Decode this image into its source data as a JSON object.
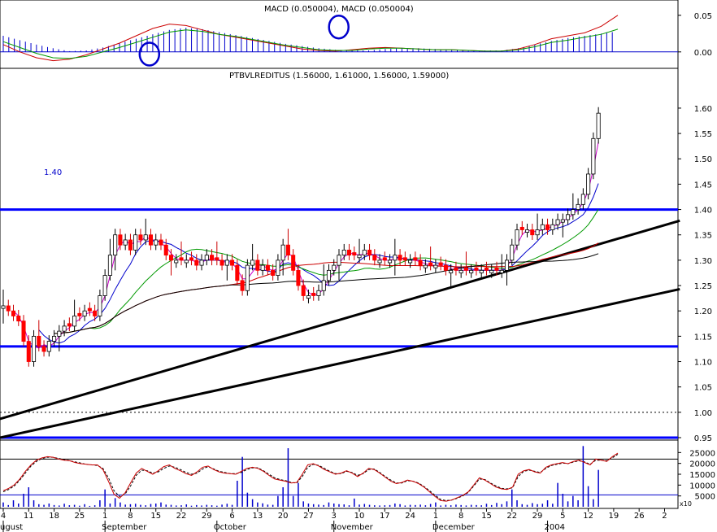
{
  "chart_data": [
    {
      "panel": "macd",
      "type": "line",
      "title": "MACD (0.050004), MACD (0.050004)",
      "ylim": [
        -0.018,
        0.062
      ],
      "y_ticks": [
        "0.05",
        "0.00"
      ],
      "y_tick_values": [
        0.05,
        0.0
      ],
      "series": [
        {
          "color": "#cc0000",
          "values": [
            0.01,
            0.0,
            -0.008,
            -0.012,
            -0.01,
            -0.004,
            0.004,
            0.012,
            0.022,
            0.032,
            0.038,
            0.036,
            0.03,
            0.024,
            0.02,
            0.016,
            0.012,
            0.008,
            0.004,
            0.002,
            0.001,
            0.003,
            0.005,
            0.006,
            0.005,
            0.004,
            0.003,
            0.003,
            0.002,
            0.001,
            0.001,
            0.004,
            0.01,
            0.018,
            0.022,
            0.026,
            0.035,
            0.05
          ]
        },
        {
          "color": "#009900",
          "values": [
            0.014,
            0.006,
            -0.002,
            -0.008,
            -0.009,
            -0.006,
            0.0,
            0.006,
            0.013,
            0.02,
            0.027,
            0.03,
            0.028,
            0.024,
            0.021,
            0.017,
            0.013,
            0.009,
            0.006,
            0.003,
            0.002,
            0.002,
            0.004,
            0.005,
            0.005,
            0.004,
            0.003,
            0.003,
            0.002,
            0.001,
            0.001,
            0.003,
            0.007,
            0.013,
            0.016,
            0.02,
            0.024,
            0.031
          ]
        }
      ],
      "histogram": [
        0.022,
        0.016,
        0.01,
        0.005,
        0.001,
        0.002,
        0.006,
        0.012,
        0.018,
        0.024,
        0.03,
        0.033,
        0.031,
        0.027,
        0.023,
        0.019,
        0.015,
        0.011,
        0.008,
        0.005,
        0.003,
        0.002,
        0.002,
        0.004,
        0.005,
        0.005,
        0.004,
        0.003,
        0.002,
        0.002,
        0.002,
        0.005,
        0.01,
        0.015,
        0.019,
        0.022,
        0.025,
        0.028
      ],
      "hist_color": "#0000cc",
      "circles": [
        {
          "x": 8.8,
          "y": -0.003
        },
        {
          "x": 20.2,
          "y": 0.034
        }
      ]
    },
    {
      "panel": "price",
      "type": "candlestick",
      "title": "PTBVLREDITUS (1.56000, 1.61000, 1.56000, 1.59000)",
      "ylim": [
        0.95,
        1.64
      ],
      "y_ticks": [
        "1.60",
        "1.55",
        "1.50",
        "1.45",
        "1.40",
        "1.35",
        "1.30",
        "1.25",
        "1.20",
        "1.15",
        "1.10",
        "1.05",
        "1.00",
        "0.95"
      ],
      "y_tick_values": [
        1.6,
        1.55,
        1.5,
        1.45,
        1.4,
        1.35,
        1.3,
        1.25,
        1.2,
        1.15,
        1.1,
        1.05,
        1.0,
        0.95
      ],
      "annotations": [
        {
          "text": "1.40",
          "color": "#0000cc"
        }
      ],
      "x_ticks": [
        {
          "label": "4",
          "i": 0
        },
        {
          "label": "11",
          "i": 5
        },
        {
          "label": "18",
          "i": 10
        },
        {
          "label": "25",
          "i": 15
        },
        {
          "label": "1",
          "i": 20
        },
        {
          "label": "8",
          "i": 25
        },
        {
          "label": "15",
          "i": 30
        },
        {
          "label": "22",
          "i": 35
        },
        {
          "label": "29",
          "i": 40
        },
        {
          "label": "6",
          "i": 45
        },
        {
          "label": "13",
          "i": 50
        },
        {
          "label": "20",
          "i": 55
        },
        {
          "label": "27",
          "i": 60
        },
        {
          "label": "3",
          "i": 65
        },
        {
          "label": "10",
          "i": 70
        },
        {
          "label": "17",
          "i": 75
        },
        {
          "label": "24",
          "i": 80
        },
        {
          "label": "1",
          "i": 85
        },
        {
          "label": "8",
          "i": 90
        },
        {
          "label": "15",
          "i": 95
        },
        {
          "label": "22",
          "i": 100
        },
        {
          "label": "29",
          "i": 105
        },
        {
          "label": "5",
          "i": 110
        },
        {
          "label": "12",
          "i": 115
        },
        {
          "label": "19",
          "i": 120
        },
        {
          "label": "26",
          "i": 125
        },
        {
          "label": "2",
          "i": 130
        }
      ],
      "month_labels": [
        {
          "label": "ugust",
          "i": 0
        },
        {
          "label": "September",
          "i": 20
        },
        {
          "label": "October",
          "i": 42
        },
        {
          "label": "November",
          "i": 65
        },
        {
          "label": "December",
          "i": 85
        },
        {
          "label": "2004",
          "i": 107
        }
      ],
      "x_count": 132,
      "close": [
        1.21,
        1.2,
        1.19,
        1.18,
        1.14,
        1.1,
        1.15,
        1.13,
        1.12,
        1.14,
        1.15,
        1.16,
        1.17,
        1.17,
        1.19,
        1.19,
        1.2,
        1.2,
        1.19,
        1.23,
        1.27,
        1.31,
        1.35,
        1.33,
        1.34,
        1.32,
        1.35,
        1.34,
        1.35,
        1.33,
        1.34,
        1.33,
        1.31,
        1.3,
        1.3,
        1.3,
        1.3,
        1.3,
        1.29,
        1.3,
        1.31,
        1.3,
        1.3,
        1.29,
        1.3,
        1.29,
        1.26,
        1.24,
        1.29,
        1.3,
        1.28,
        1.29,
        1.28,
        1.27,
        1.3,
        1.33,
        1.31,
        1.28,
        1.25,
        1.23,
        1.23,
        1.23,
        1.24,
        1.26,
        1.28,
        1.29,
        1.31,
        1.32,
        1.31,
        1.31,
        1.31,
        1.32,
        1.31,
        1.3,
        1.3,
        1.3,
        1.3,
        1.31,
        1.3,
        1.3,
        1.3,
        1.3,
        1.29,
        1.29,
        1.29,
        1.29,
        1.29,
        1.28,
        1.28,
        1.28,
        1.28,
        1.28,
        1.28,
        1.28,
        1.28,
        1.28,
        1.28,
        1.28,
        1.28,
        1.3,
        1.33,
        1.36,
        1.36,
        1.36,
        1.35,
        1.36,
        1.37,
        1.36,
        1.37,
        1.38,
        1.38,
        1.39,
        1.4,
        1.41,
        1.43,
        1.47,
        1.54,
        1.59
      ],
      "open_dir": [
        1,
        -1,
        -1,
        -1,
        -1,
        -1,
        1,
        -1,
        -1,
        1,
        1,
        1,
        1,
        -1,
        1,
        -1,
        1,
        -1,
        -1,
        1,
        1,
        1,
        1,
        -1,
        1,
        -1,
        1,
        -1,
        1,
        -1,
        1,
        -1,
        -1,
        -1,
        1,
        -1,
        1,
        -1,
        -1,
        1,
        1,
        -1,
        -1,
        -1,
        1,
        -1,
        -1,
        -1,
        1,
        1,
        -1,
        1,
        -1,
        -1,
        1,
        1,
        -1,
        -1,
        -1,
        -1,
        1,
        -1,
        1,
        1,
        1,
        1,
        1,
        1,
        -1,
        -1,
        1,
        1,
        -1,
        -1,
        1,
        -1,
        1,
        1,
        -1,
        -1,
        1,
        -1,
        -1,
        1,
        -1,
        1,
        -1,
        -1,
        1,
        -1,
        1,
        -1,
        1,
        -1,
        1,
        -1,
        1,
        -1,
        1,
        1,
        1,
        1,
        -1,
        1,
        -1,
        1,
        1,
        -1,
        1,
        1,
        1,
        1,
        1,
        1,
        1,
        1,
        1,
        1
      ],
      "ma_series": [
        {
          "color": "#cc00cc",
          "period": 3
        },
        {
          "color": "#0000cc",
          "period": 8
        },
        {
          "color": "#009900",
          "period": 18
        },
        {
          "color": "#cc0000",
          "period": 45
        },
        {
          "color": "#000000",
          "period": 80
        }
      ],
      "hlines": [
        {
          "y": 1.4,
          "color": "#0000ff",
          "width": 3
        },
        {
          "y": 1.13,
          "color": "#0000ff",
          "width": 3
        },
        {
          "y": 0.95,
          "color": "#0000ff",
          "width": 3
        }
      ],
      "dotted_line": 1.0,
      "trendlines": [
        {
          "x1": -2,
          "y1": 0.983,
          "x2": 133,
          "y2": 1.378
        },
        {
          "x1": -2,
          "y1": 0.947,
          "x2": 133,
          "y2": 1.243
        }
      ]
    },
    {
      "panel": "volume",
      "type": "bar",
      "ylim": [
        0,
        30000
      ],
      "y_ticks": [
        "25000",
        "20000",
        "15000",
        "10000",
        "5000"
      ],
      "y_tick_values": [
        25000,
        20000,
        15000,
        10000,
        5000
      ],
      "multiplier_label": "x10",
      "hlines": [
        22000,
        5500
      ],
      "volume": [
        2000,
        800,
        3000,
        1500,
        6000,
        9000,
        3000,
        1200,
        900,
        1500,
        800,
        600,
        1400,
        700,
        900,
        500,
        1200,
        400,
        700,
        3000,
        8000,
        1500,
        4000,
        2000,
        1000,
        1200,
        1400,
        900,
        700,
        1300,
        1500,
        2000,
        1000,
        900,
        600,
        700,
        1100,
        500,
        800,
        600,
        900,
        700,
        500,
        1000,
        1400,
        900,
        12000,
        23000,
        6500,
        3500,
        2000,
        1600,
        1000,
        900,
        5000,
        9000,
        27000,
        5000,
        11000,
        2500,
        1500,
        1200,
        1000,
        800,
        2000,
        1500,
        1200,
        1100,
        700,
        3800,
        1000,
        1300,
        900,
        700,
        600,
        700,
        800,
        1500,
        1200,
        600,
        900,
        800,
        1000,
        700,
        1300,
        2000,
        600,
        900,
        700,
        1000,
        800,
        600,
        900,
        800,
        700,
        1400,
        800,
        1800,
        1200,
        2500,
        8000,
        3000,
        1200,
        900,
        1700,
        1200,
        1400,
        3000,
        1400,
        11000,
        6000,
        2500,
        5000,
        3000,
        28000,
        9500,
        3500,
        17000
      ],
      "stoch_red": [
        22,
        26,
        32,
        42,
        55,
        66,
        74,
        78,
        80,
        79,
        76,
        74,
        73,
        70,
        68,
        67,
        66,
        66,
        58,
        38,
        16,
        9,
        18,
        35,
        52,
        60,
        55,
        50,
        56,
        63,
        66,
        60,
        56,
        51,
        48,
        54,
        62,
        64,
        58,
        54,
        52,
        51,
        50,
        55,
        60,
        62,
        60,
        55,
        48,
        42,
        40,
        38,
        35,
        36,
        50,
        66,
        68,
        64,
        58,
        54,
        50,
        52,
        56,
        52,
        46,
        52,
        60,
        58,
        52,
        45,
        38,
        34,
        36,
        40,
        38,
        34,
        28,
        20,
        12,
        5,
        4,
        6,
        10,
        14,
        20,
        32,
        44,
        40,
        34,
        28,
        25,
        24,
        28,
        50,
        56,
        58,
        54,
        52,
        62,
        66,
        68,
        70,
        68,
        72,
        74,
        70,
        66,
        76,
        74,
        72,
        80,
        86
      ],
      "stoch_black": [
        20,
        24,
        30,
        40,
        52,
        64,
        72,
        77,
        79,
        79,
        77,
        75,
        73,
        71,
        69,
        67,
        66,
        65,
        60,
        44,
        22,
        12,
        16,
        30,
        48,
        57,
        56,
        52,
        54,
        60,
        64,
        62,
        58,
        53,
        50,
        52,
        59,
        63,
        59,
        55,
        53,
        51,
        51,
        53,
        58,
        61,
        61,
        56,
        50,
        44,
        41,
        39,
        36,
        35,
        46,
        62,
        67,
        65,
        60,
        55,
        51,
        51,
        55,
        53,
        48,
        51,
        58,
        59,
        53,
        46,
        40,
        35,
        35,
        39,
        38,
        35,
        29,
        22,
        14,
        7,
        5,
        6,
        9,
        13,
        19,
        30,
        42,
        41,
        35,
        30,
        26,
        25,
        27,
        46,
        55,
        57,
        55,
        53,
        60,
        65,
        67,
        69,
        68,
        71,
        73,
        71,
        67,
        74,
        74,
        73,
        78,
        84
      ]
    }
  ]
}
